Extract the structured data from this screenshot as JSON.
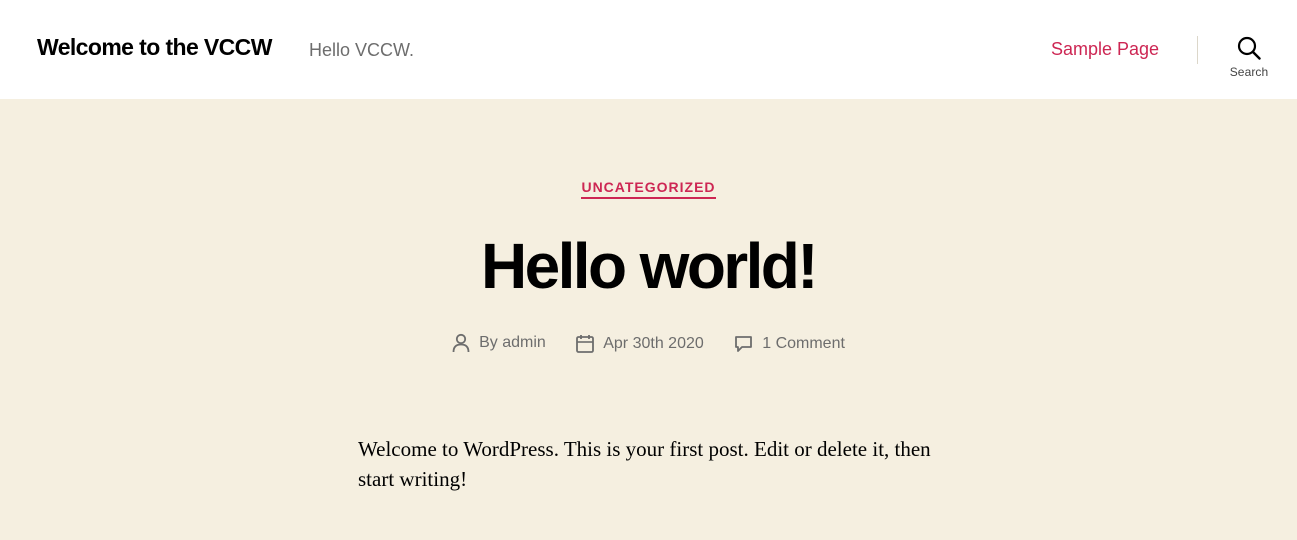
{
  "header": {
    "site_title": "Welcome to the VCCW",
    "site_description": "Hello VCCW.",
    "menu": [
      {
        "label": "Sample Page"
      }
    ],
    "search_label": "Search",
    "icons": {
      "search": "search-icon"
    }
  },
  "post": {
    "category": "UNCATEGORIZED",
    "title": "Hello world!",
    "meta": {
      "author": "By admin",
      "date": "Apr 30th 2020",
      "comments": "1 Comment",
      "icons": [
        "user-icon",
        "calendar-icon",
        "comment-icon"
      ]
    },
    "content": "Welcome to WordPress. This is your first post. Edit or delete it, then start writing!"
  },
  "colors": {
    "accent": "#cd2653",
    "background": "#f5efe0",
    "header_background": "#ffffff",
    "meta_text": "#6d6d6d"
  }
}
